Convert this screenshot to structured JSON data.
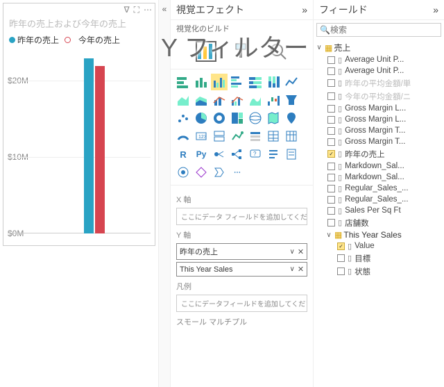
{
  "canvas": {
    "title": "昨年の売上および今年の売上",
    "legend": [
      {
        "label": "昨年の売上",
        "color": "#2aa3c4"
      },
      {
        "label": "今年の売上",
        "color": "#d64550"
      }
    ]
  },
  "chart_data": {
    "type": "bar",
    "title": "昨年の売上および今年の売上",
    "xlabel": "",
    "ylabel": "",
    "ylim": [
      0,
      24000000
    ],
    "yticks": [
      0,
      10000000,
      20000000
    ],
    "ytick_labels": [
      "$0M",
      "$10M",
      "$20M"
    ],
    "categories": [
      ""
    ],
    "series": [
      {
        "name": "昨年の売上",
        "values": [
          23000000
        ],
        "color": "#2aa3c4"
      },
      {
        "name": "今年の売上",
        "values": [
          22000000
        ],
        "color": "#d64550"
      }
    ]
  },
  "overlay": {
    "text": "Y フィルター"
  },
  "visualPane": {
    "title": "視覚エフェクト",
    "buildLabel": "視覚化のビルド",
    "wells": {
      "x": {
        "label": "X 軸",
        "placeholder": "ここにデータ フィールドを追加してくださ"
      },
      "y": {
        "label": "Y 軸",
        "items": [
          "昨年の売上",
          "This Year Sales"
        ]
      },
      "legend": {
        "label": "凡例",
        "placeholder": "ここにデータフィールドを追加してください"
      },
      "smallMult": {
        "label": "スモール マルチプル"
      }
    }
  },
  "fieldsPane": {
    "title": "フィールド",
    "searchPlaceholder": "検索",
    "tables": [
      {
        "name": "売上",
        "expanded": true,
        "fields": [
          {
            "name": "Average Unit P...",
            "checked": false
          },
          {
            "name": "Average Unit P...",
            "checked": false
          },
          {
            "name": "昨年の平均金額/単",
            "checked": false,
            "greyed": true
          },
          {
            "name": "今年の平均金額/ニ",
            "checked": false,
            "greyed": true
          },
          {
            "name": "Gross Margin L...",
            "checked": false
          },
          {
            "name": "Gross Margin L...",
            "checked": false
          },
          {
            "name": "Gross Margin T...",
            "checked": false
          },
          {
            "name": "Gross Margin T...",
            "checked": false
          },
          {
            "name": "昨年の売上",
            "checked": true
          },
          {
            "name": "Markdown_Sal...",
            "checked": false
          },
          {
            "name": "Markdown_Sal...",
            "checked": false
          },
          {
            "name": "Regular_Sales_...",
            "checked": false
          },
          {
            "name": "Regular_Sales_...",
            "checked": false
          },
          {
            "name": "Sales Per Sq Ft",
            "checked": false
          },
          {
            "name": "店舗数",
            "checked": false
          }
        ]
      },
      {
        "name": "This Year Sales",
        "expanded": true,
        "fields": [
          {
            "name": "Value",
            "checked": true
          },
          {
            "name": "目標",
            "checked": false
          },
          {
            "name": "状態",
            "checked": false
          }
        ]
      }
    ]
  }
}
